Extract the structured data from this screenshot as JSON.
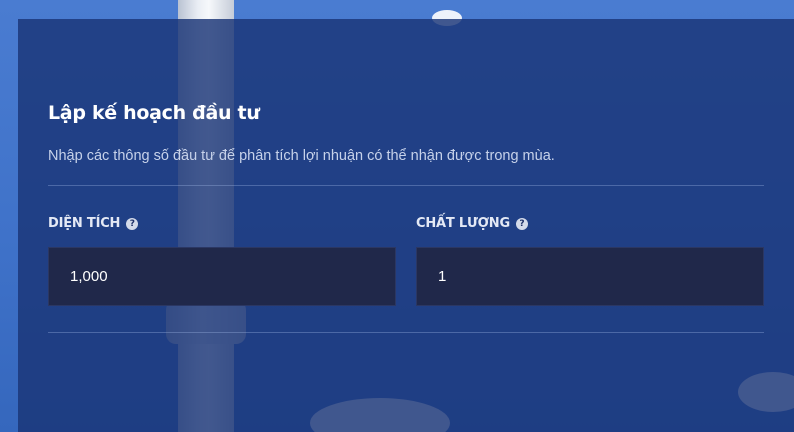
{
  "panel": {
    "title": "Lập kế hoạch đầu tư",
    "subtitle": "Nhập các thông số đầu tư để phân tích lợi nhuận có thể nhận được trong mùa."
  },
  "fields": {
    "area": {
      "label": "DIỆN TÍCH",
      "value": "1,000"
    },
    "quality": {
      "label": "CHẤT LƯỢNG",
      "value": "1"
    }
  },
  "icons": {
    "help": "help-icon"
  },
  "colors": {
    "panel_bg": "#1a3476",
    "input_bg": "#20284a",
    "sky": "#4a7cd1"
  }
}
